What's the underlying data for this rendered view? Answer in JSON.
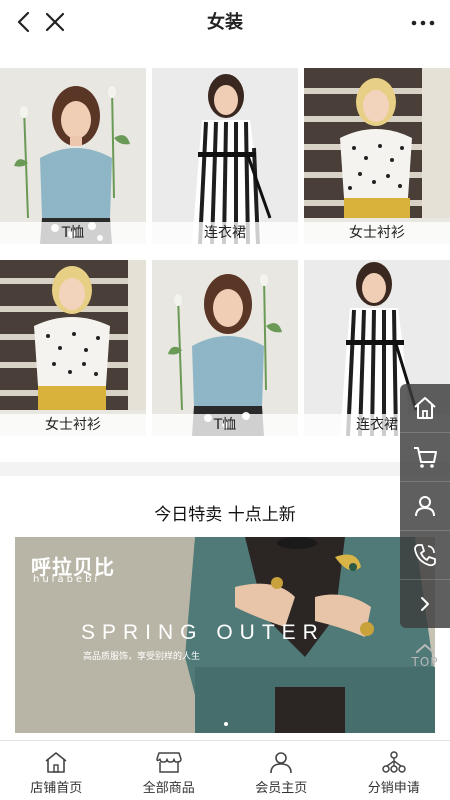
{
  "header": {
    "title": "女装",
    "back_icon": "chevron-left-icon",
    "close_icon": "close-icon",
    "more_icon": "more-dots-icon"
  },
  "products": [
    {
      "label": "T恤"
    },
    {
      "label": "连衣裙"
    },
    {
      "label": "女士衬衫"
    },
    {
      "label": "女士衬衫"
    },
    {
      "label": "T恤"
    },
    {
      "label": "连衣裙"
    }
  ],
  "section": {
    "title": "今日特卖 十点上新"
  },
  "banner": {
    "brand_cn": "呼拉贝比",
    "brand_en": "hulabebi",
    "headline": "SPRING OUTER",
    "slogan": "高品质服饰，享受别样的人生"
  },
  "sidebar": {
    "items": [
      "home-icon",
      "cart-icon",
      "user-icon",
      "phone-icon",
      "chevron-right-icon"
    ],
    "top_label": "TOP"
  },
  "bottom_nav": {
    "items": [
      {
        "label": "店铺首页",
        "icon": "store-home-icon"
      },
      {
        "label": "全部商品",
        "icon": "shop-icon"
      },
      {
        "label": "会员主页",
        "icon": "member-icon"
      },
      {
        "label": "分销申请",
        "icon": "distribution-icon"
      }
    ]
  },
  "colors": {
    "sidebar_bg": "#3c3c3c",
    "divider_band": "#f3f3f3",
    "banner_bg": "#b9b5a6",
    "jacket": "#4f7a78"
  }
}
